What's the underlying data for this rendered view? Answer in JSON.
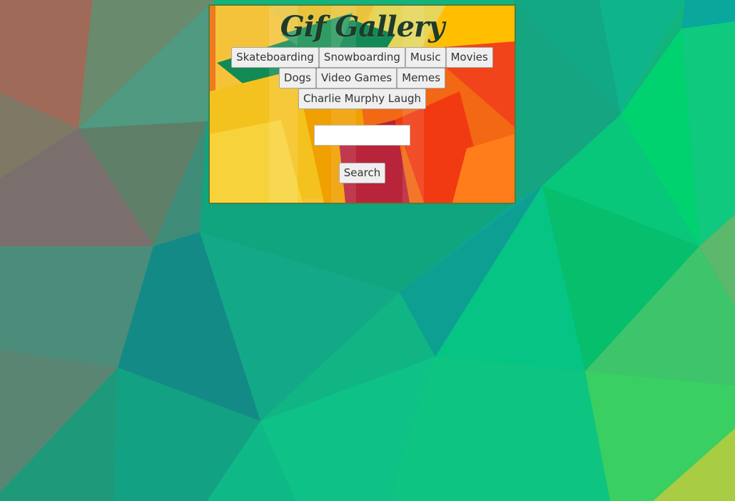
{
  "page": {
    "title": "Gif Gallery"
  },
  "topics": [
    "Skateboarding",
    "Snowboarding",
    "Music",
    "Movies",
    "Dogs",
    "Video Games",
    "Memes",
    "Charlie Murphy Laugh"
  ],
  "search": {
    "value": "",
    "placeholder": "",
    "button_label": "Search"
  },
  "colors": {
    "background_primary": "#12b67f",
    "panel_border": "#4f7f3c",
    "title_text": "#1f3b2a",
    "button_bg": "#efefef"
  }
}
